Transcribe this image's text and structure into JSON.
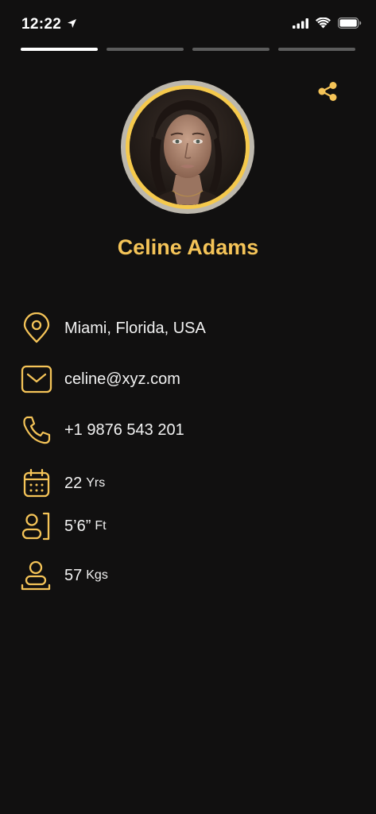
{
  "status": {
    "time": "12:22"
  },
  "progress": {
    "segments": 4,
    "active_index": 0
  },
  "profile": {
    "name": "Celine Adams",
    "location": "Miami, Florida, USA",
    "email": "celine@xyz.com",
    "phone": "+1 9876 543 201",
    "age": "22",
    "age_unit": "Yrs",
    "height": "5’6”",
    "height_unit": "Ft",
    "weight": "57",
    "weight_unit": "Kgs"
  },
  "theme": {
    "accent": "#f5c458",
    "background": "#111010",
    "text": "#f2f2f2"
  }
}
